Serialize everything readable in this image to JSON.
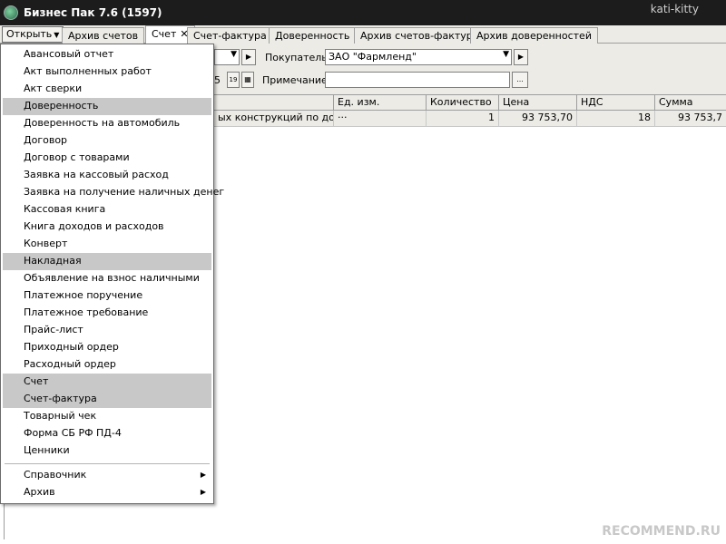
{
  "window": {
    "title": "Бизнес Пак 7.6 (1597)",
    "user_watermark": "kati-kitty"
  },
  "tabbar": {
    "open_button": "Открыть",
    "tabs": [
      {
        "label": "Архив счетов"
      },
      {
        "label": "Счет",
        "close": "✕"
      },
      {
        "label": "Счет-фактура"
      },
      {
        "label": "Доверенность"
      },
      {
        "label": "Архив счетов-фактур"
      },
      {
        "label": "Архив доверенностей"
      }
    ]
  },
  "form": {
    "buyer_label": "Покупатель",
    "buyer_value": "ЗАО \"Фармленд\"",
    "date_fragment": "5",
    "calendar_icon": "19",
    "note_label": "Примечание",
    "note_value": "",
    "ellipsis": "..."
  },
  "grid": {
    "headers": [
      "Ед. изм.",
      "Количество",
      "Цена",
      "НДС",
      "Сумма"
    ],
    "row": {
      "name": "ых конструкций по договор",
      "unit": "···",
      "qty": "1",
      "price": "93 753,70",
      "vat": "18",
      "sum": "93 753,7"
    }
  },
  "menu": {
    "items": [
      {
        "label": "Авансовый отчет"
      },
      {
        "label": "Акт выполненных работ"
      },
      {
        "label": "Акт сверки"
      },
      {
        "label": "Доверенность",
        "highlighted": true
      },
      {
        "label": "Доверенность на автомобиль"
      },
      {
        "label": "Договор"
      },
      {
        "label": "Договор с товарами"
      },
      {
        "label": "Заявка на кассовый расход"
      },
      {
        "label": "Заявка на получение наличных денег"
      },
      {
        "label": "Кассовая книга"
      },
      {
        "label": "Книга доходов и расходов"
      },
      {
        "label": "Конверт"
      },
      {
        "label": "Накладная",
        "highlighted": true
      },
      {
        "label": "Объявление на взнос наличными"
      },
      {
        "label": "Платежное поручение"
      },
      {
        "label": "Платежное требование"
      },
      {
        "label": "Прайс-лист"
      },
      {
        "label": "Приходный ордер"
      },
      {
        "label": "Расходный ордер"
      },
      {
        "label": "Счет",
        "highlighted": true
      },
      {
        "label": "Счет-фактура",
        "highlighted": true
      },
      {
        "label": "Товарный чек"
      },
      {
        "label": "Форма СБ РФ ПД-4"
      },
      {
        "label": "Ценники"
      }
    ],
    "submenus": [
      {
        "label": "Справочник"
      },
      {
        "label": "Архив"
      }
    ]
  },
  "watermark": "RECOMMEND.RU"
}
